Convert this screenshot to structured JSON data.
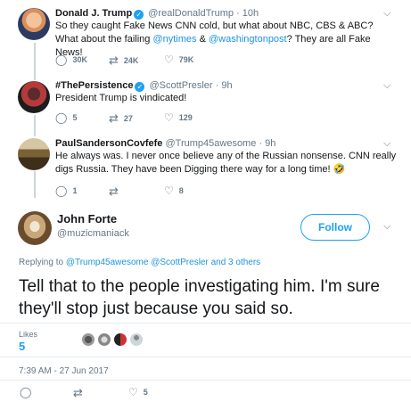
{
  "tweets": [
    {
      "name": "Donald J. Trump",
      "handle": "@realDonaldTrump",
      "time": "10h",
      "text_pre": "So they caught Fake News CNN cold, but what about NBC, CBS & ABC? What about the failing ",
      "link1": "@nytimes",
      "text_mid": " & ",
      "link2": "@washingtonpost",
      "text_post": "? They are all Fake News!",
      "replies": "30K",
      "retweets": "24K",
      "likes": "79K"
    },
    {
      "name": "#ThePersistence",
      "handle": "@ScottPresler",
      "time": "9h",
      "text": "President Trump is vindicated!",
      "replies": "5",
      "retweets": "27",
      "likes": "129"
    },
    {
      "name": "PaulSandersonCovfefe",
      "handle": "@Trump45awesome",
      "time": "9h",
      "text": "He always was. I never once believe any of the Russian nonsense. CNN really digs Russia. They have been Digging there way for a long time! 🤣",
      "replies": "1",
      "retweets": "",
      "likes": "8"
    }
  ],
  "main": {
    "name": "John Forte",
    "handle": "@muzicmaniack",
    "follow_label": "Follow",
    "replying_prefix": "Replying to ",
    "replying_link1": "@Trump45awesome",
    "replying_link2": "@ScottPresler",
    "replying_suffix": " and 3 others",
    "text": "Tell that to the people investigating him. I'm sure they'll stop just because you said so.",
    "likes_label": "Likes",
    "likes_count": "5",
    "timestamp": "7:39 AM - 27 Jun 2017",
    "replies": "",
    "retweets": "",
    "likes": "5"
  },
  "icons": {
    "reply": "reply-icon",
    "retweet": "retweet-icon",
    "like": "heart-icon",
    "caret": "chevron-down-icon",
    "verified": "verified-badge-icon"
  },
  "colors": {
    "accent": "#1da1f2",
    "link": "#1b95e0",
    "muted": "#657786",
    "thread_line": "#ccd6dd"
  }
}
